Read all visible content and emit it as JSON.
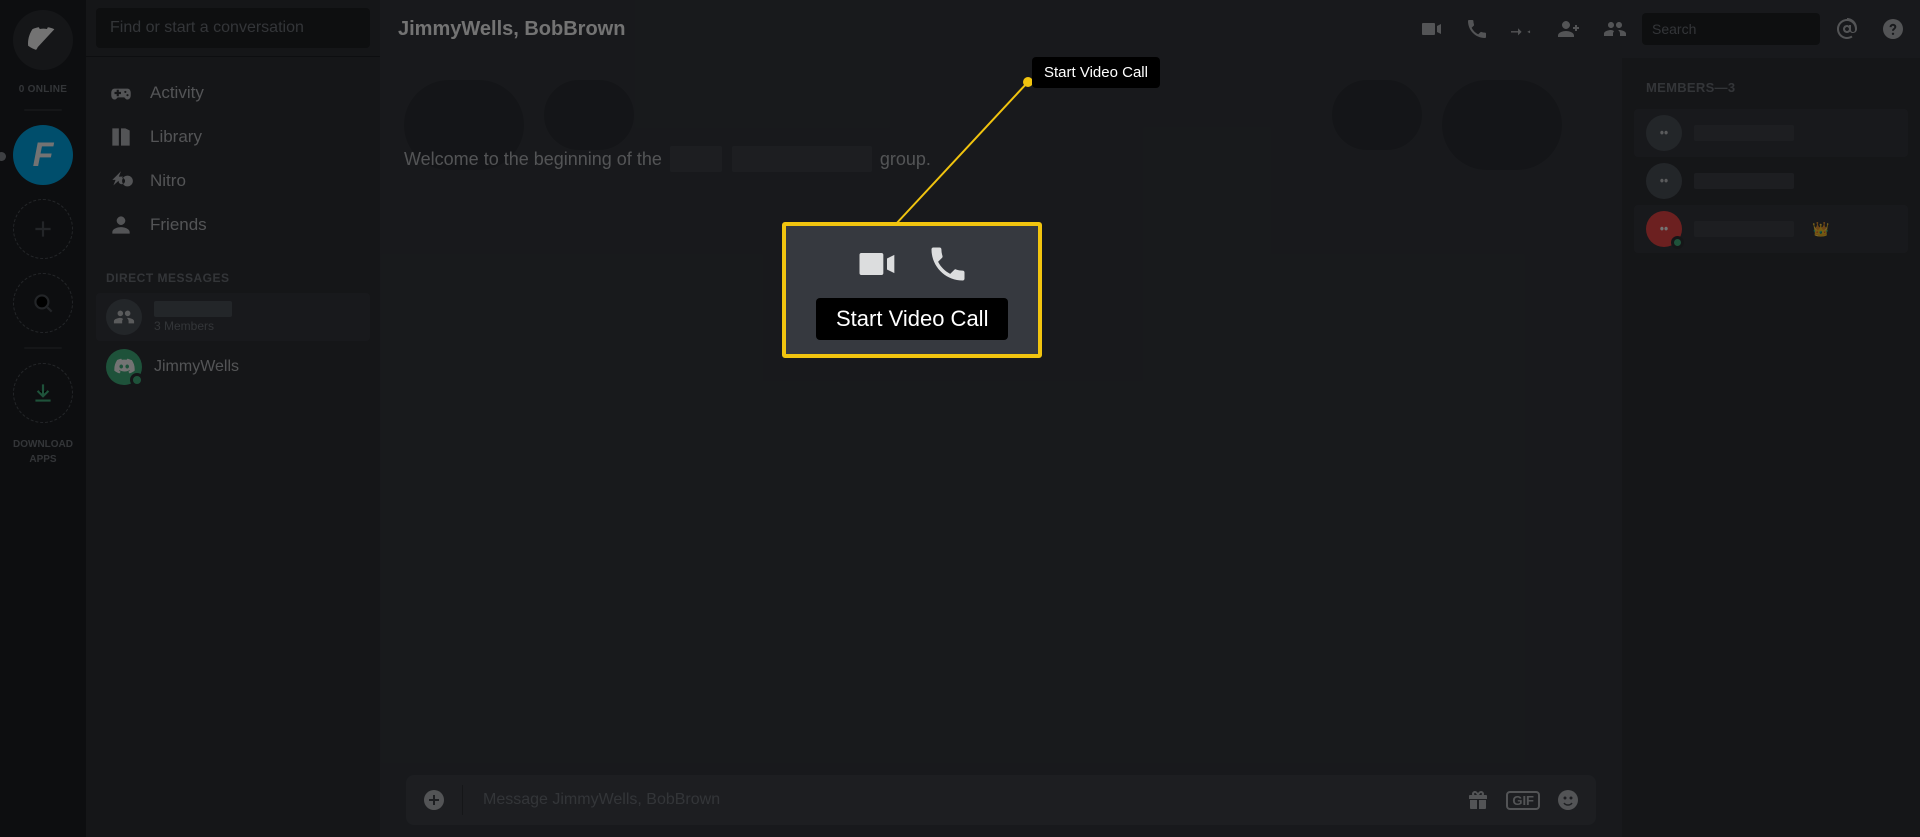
{
  "servers": {
    "online_label": "0 ONLINE",
    "guild_letter": "F",
    "download_label": "DOWNLOAD\nAPPS"
  },
  "sidebar": {
    "search_placeholder": "Find or start a conversation",
    "nav": {
      "activity": "Activity",
      "library": "Library",
      "nitro": "Nitro",
      "friends": "Friends"
    },
    "dm_header": "DIRECT MESSAGES",
    "dms": {
      "group_sub": "3 Members",
      "user1": "JimmyWells"
    }
  },
  "header": {
    "title": "JimmyWells, BobBrown",
    "tooltip_videocall": "Start Video Call",
    "search_placeholder": "Search"
  },
  "chat": {
    "welcome_pre": "Welcome to the beginning of the",
    "welcome_post": "group."
  },
  "composer": {
    "placeholder": "Message JimmyWells, BobBrown",
    "gif": "GIF"
  },
  "members": {
    "header": "MEMBERS—3"
  },
  "annotation": {
    "zoom_tooltip": "Start Video Call"
  }
}
